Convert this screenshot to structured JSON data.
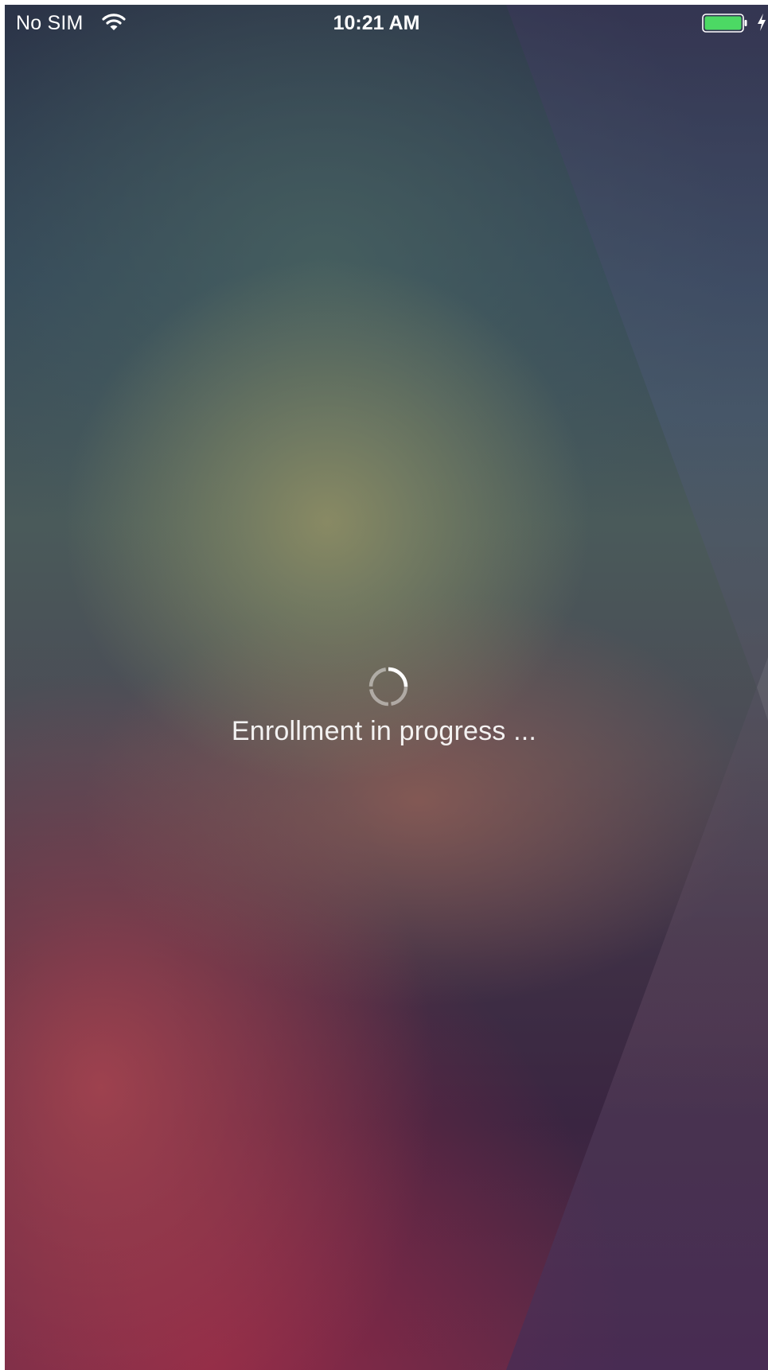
{
  "status_bar": {
    "carrier": "No SIM",
    "time": "10:21 AM",
    "wifi_icon": "wifi-icon",
    "battery_icon": "battery-charging-icon",
    "battery_color": "#4cd964"
  },
  "main": {
    "spinner_icon": "activity-spinner-icon",
    "progress_text": "Enrollment in progress ..."
  }
}
